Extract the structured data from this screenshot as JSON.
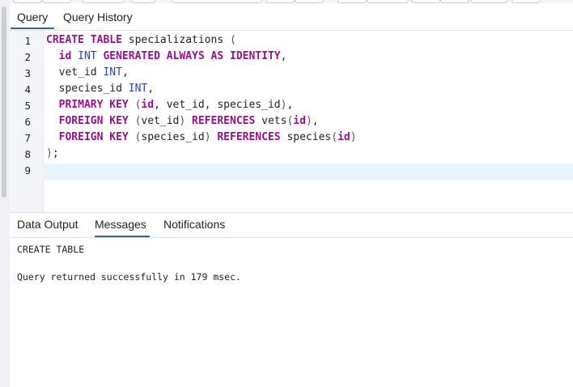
{
  "editor_tabs": [
    {
      "label": "Query",
      "active": true
    },
    {
      "label": "Query History",
      "active": false
    }
  ],
  "editor": {
    "line_numbers": [
      "1",
      "2",
      "3",
      "4",
      "5",
      "6",
      "7",
      "8",
      "9"
    ],
    "active_line": 9,
    "lines": [
      [
        {
          "t": "CREATE TABLE",
          "c": "kw"
        },
        {
          "t": " specializations ",
          "c": ""
        },
        {
          "t": "(",
          "c": "pn"
        }
      ],
      [
        {
          "t": "  ",
          "c": ""
        },
        {
          "t": "id",
          "c": "kw"
        },
        {
          "t": " ",
          "c": ""
        },
        {
          "t": "INT",
          "c": "ty"
        },
        {
          "t": " ",
          "c": ""
        },
        {
          "t": "GENERATED ALWAYS AS IDENTITY",
          "c": "kw"
        },
        {
          "t": ",",
          "c": ""
        }
      ],
      [
        {
          "t": "  vet_id ",
          "c": ""
        },
        {
          "t": "INT",
          "c": "ty"
        },
        {
          "t": ",",
          "c": ""
        }
      ],
      [
        {
          "t": "  species_id ",
          "c": ""
        },
        {
          "t": "INT",
          "c": "ty"
        },
        {
          "t": ",",
          "c": ""
        }
      ],
      [
        {
          "t": "  ",
          "c": ""
        },
        {
          "t": "PRIMARY KEY",
          "c": "kw"
        },
        {
          "t": " ",
          "c": ""
        },
        {
          "t": "(",
          "c": "pn"
        },
        {
          "t": "id",
          "c": "kw"
        },
        {
          "t": ", vet_id, species_id",
          "c": ""
        },
        {
          "t": ")",
          "c": "pn"
        },
        {
          "t": ",",
          "c": ""
        }
      ],
      [
        {
          "t": "  ",
          "c": ""
        },
        {
          "t": "FOREIGN KEY",
          "c": "kw"
        },
        {
          "t": " ",
          "c": ""
        },
        {
          "t": "(",
          "c": "pn"
        },
        {
          "t": "vet_id",
          "c": ""
        },
        {
          "t": ")",
          "c": "pn"
        },
        {
          "t": " ",
          "c": ""
        },
        {
          "t": "REFERENCES",
          "c": "kw"
        },
        {
          "t": " vets",
          "c": ""
        },
        {
          "t": "(",
          "c": "pn"
        },
        {
          "t": "id",
          "c": "kw"
        },
        {
          "t": ")",
          "c": "pn"
        },
        {
          "t": ",",
          "c": ""
        }
      ],
      [
        {
          "t": "  ",
          "c": ""
        },
        {
          "t": "FOREIGN KEY",
          "c": "kw"
        },
        {
          "t": " ",
          "c": ""
        },
        {
          "t": "(",
          "c": "pn"
        },
        {
          "t": "species_id",
          "c": ""
        },
        {
          "t": ")",
          "c": "pn"
        },
        {
          "t": " ",
          "c": ""
        },
        {
          "t": "REFERENCES",
          "c": "kw"
        },
        {
          "t": " species",
          "c": ""
        },
        {
          "t": "(",
          "c": "pn"
        },
        {
          "t": "id",
          "c": "kw"
        },
        {
          "t": ")",
          "c": "pn"
        }
      ],
      [
        {
          "t": ")",
          "c": "pn"
        },
        {
          "t": ";",
          "c": ""
        }
      ],
      []
    ]
  },
  "output_tabs": [
    {
      "label": "Data Output",
      "active": false
    },
    {
      "label": "Messages",
      "active": true
    },
    {
      "label": "Notifications",
      "active": false
    }
  ],
  "messages": {
    "line1": "CREATE TABLE",
    "line2": "Query returned successfully in 179 msec."
  },
  "colors": {
    "keyword": "#980f8e",
    "type": "#1d45c4",
    "active_tab_underline": "#326690",
    "active_line_bg": "#eaf4fc"
  }
}
